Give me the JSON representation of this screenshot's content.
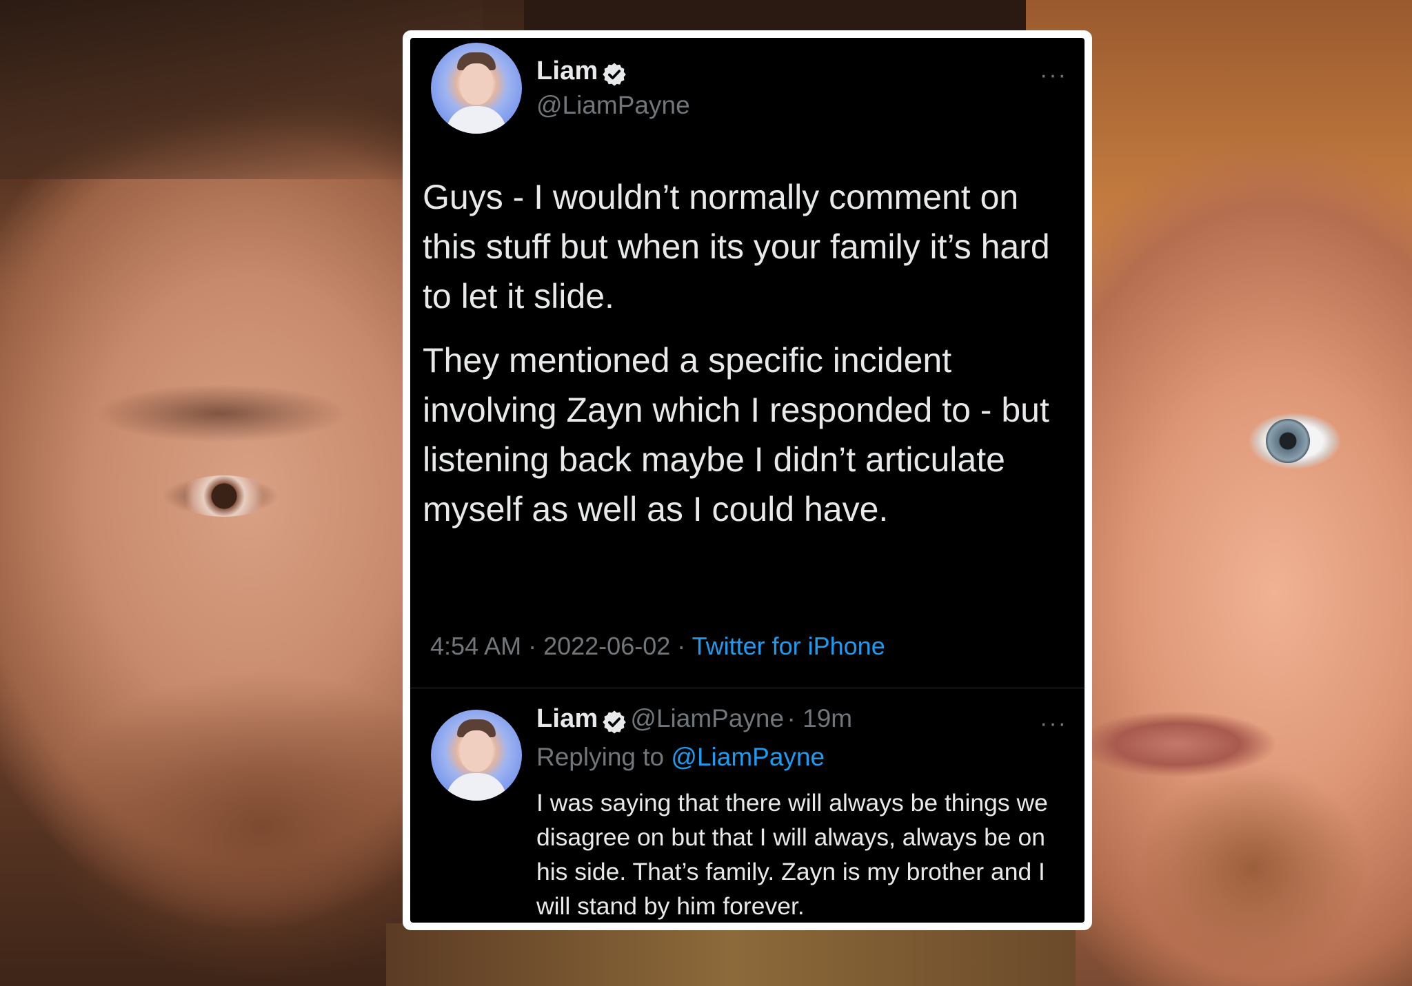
{
  "tweet": {
    "author_name": "Liam",
    "author_handle": "@LiamPayne",
    "more_label": "···",
    "paragraphs": [
      "Guys - I wouldn’t normally comment on this stuff but when its your family it’s hard to let it slide.",
      "They mentioned a specific incident involving Zayn which I responded to  - but listening back maybe I didn’t articulate myself as well as I could have."
    ],
    "time": "4:54 AM",
    "date": "2022-06-02",
    "separator": " · ",
    "source": "Twitter for iPhone"
  },
  "reply": {
    "author_name": "Liam",
    "author_handle": "@LiamPayne",
    "age": "· 19m",
    "more_label": "···",
    "replying_to_label": "Replying to",
    "replying_to_handle": "@LiamPayne",
    "text": "I was saying that there will always be things we disagree on but that I will always, always be on his side. That’s family. Zayn is my brother and I will stand by him forever."
  },
  "colors": {
    "card_background": "#000000",
    "card_border": "#ffffff",
    "primary_text": "#e7e9ea",
    "secondary_text": "#71767b",
    "link": "#1d9bf0"
  }
}
